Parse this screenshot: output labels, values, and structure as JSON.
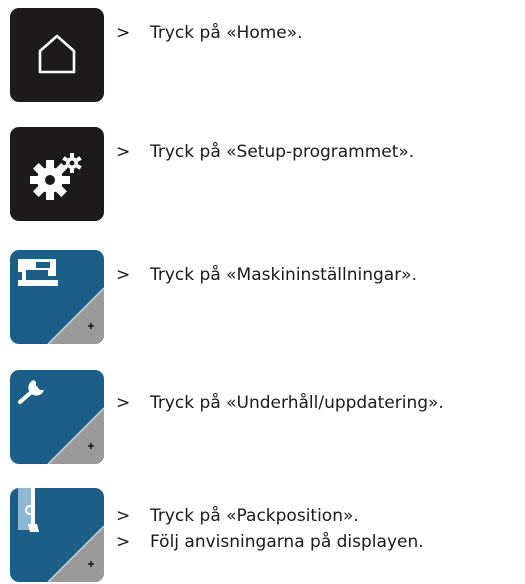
{
  "steps": [
    {
      "icon": "home-icon",
      "lines": [
        {
          "bullet": ">",
          "text": "Tryck på «Home»."
        }
      ]
    },
    {
      "icon": "gears-icon",
      "lines": [
        {
          "bullet": ">",
          "text": "Tryck på «Setup-programmet»."
        }
      ]
    },
    {
      "icon": "sewing-machine-icon",
      "lines": [
        {
          "bullet": ">",
          "text": "Tryck på «Maskininställningar»."
        }
      ]
    },
    {
      "icon": "wrench-icon",
      "lines": [
        {
          "bullet": ">",
          "text": "Tryck på «Underhåll/uppdatering»."
        }
      ]
    },
    {
      "icon": "packing-position-icon",
      "lines": [
        {
          "bullet": ">",
          "text": "Tryck på «Packposition»."
        },
        {
          "bullet": ">",
          "text": "Följ anvisningarna på displayen."
        }
      ]
    }
  ],
  "colors": {
    "dark_button": "#1c1a1b",
    "blue_button": "#1b5f88",
    "corner_badge": "#9a9a9a"
  }
}
